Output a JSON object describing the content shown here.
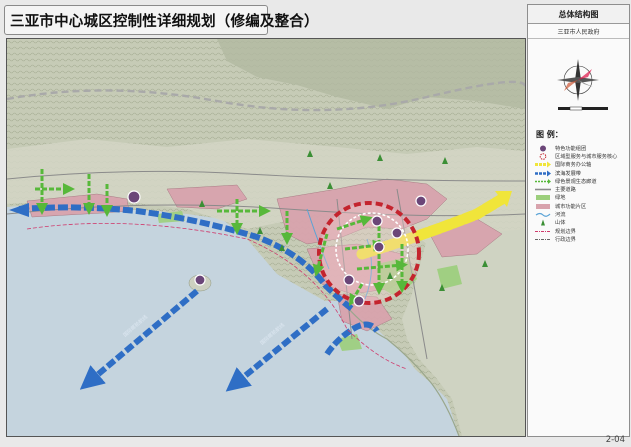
{
  "title": "三亚市中心城区控制性详细规划（修编及整合）",
  "panel": {
    "heading": "总体结构图",
    "subheading": "三亚市人民政府"
  },
  "legend": {
    "title": "图 例：",
    "items": [
      {
        "label": "特色功能组团",
        "icon": "purple-circle-icon"
      },
      {
        "label": "区域型服务与城市服务核心",
        "icon": "red-dashed-ring-icon"
      },
      {
        "label": "国际商务办公轴",
        "icon": "yellow-axis-arrow-icon"
      },
      {
        "label": "滨海发展带",
        "icon": "blue-dashed-band-icon"
      },
      {
        "label": "绿色景观生态廊道",
        "icon": "green-dashed-arrow-icon"
      },
      {
        "label": "主要道路",
        "icon": "gray-road-icon"
      },
      {
        "label": "绿地",
        "icon": "green-fill-icon"
      },
      {
        "label": "城市功能片区",
        "icon": "pink-fill-icon"
      },
      {
        "label": "河流",
        "icon": "blue-river-icon"
      },
      {
        "label": "山体",
        "icon": "green-tree-icon"
      },
      {
        "label": "规划边界",
        "icon": "red-boundary-line-icon"
      },
      {
        "label": "行政边界",
        "icon": "gray-boundary-line-icon"
      }
    ]
  },
  "map": {
    "sea_labels": [
      "国际邮轮航线",
      "国际邮轮航线"
    ],
    "colors": {
      "sea": "#c5d4de",
      "land": "#d4d6c6",
      "mountain": "#b5bca5",
      "urban": "#d8a3ad",
      "coast_band": "#2f6ec5",
      "axis": "#f0e53a",
      "green_corridor": "#57b83a",
      "core_ring": "#c4242e",
      "cluster": "#6b4678"
    }
  },
  "page_number": "2-04"
}
